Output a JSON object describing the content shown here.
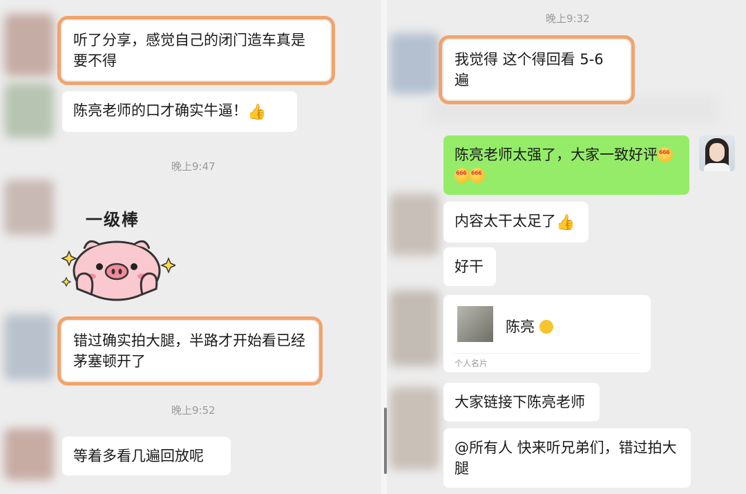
{
  "left": {
    "messages": [
      {
        "text": "听了分享，感觉自己的闭门造车真是要不得"
      },
      {
        "text": "陈亮老师的口才确实牛逼！"
      },
      {
        "text": "错过确实拍大腿，半路才开始看已经茅塞顿开了"
      },
      {
        "text": "等着多看几遍回放呢"
      }
    ],
    "times": [
      "晚上9:47",
      "晚上9:52"
    ],
    "sticker_text": "一级棒"
  },
  "right": {
    "time": "晚上9:32",
    "messages": [
      {
        "text": "我觉得 这个得回看 5-6 遍"
      },
      {
        "text": "陈亮老师太强了，大家一致好评"
      },
      {
        "text": "内容太干太足了"
      },
      {
        "text": "好干"
      },
      {
        "text": "大家链接下陈亮老师"
      },
      {
        "text": "@所有人  快来听兄弟们，错过拍大腿"
      }
    ],
    "card": {
      "name": "陈亮",
      "type": "个人名片"
    }
  },
  "icons": [
    "thumbs-up-icon",
    "emoji-666-icon",
    "tongue-emoji-icon"
  ],
  "colors": {
    "highlight": "#f2a36b",
    "sent_bubble": "#95ec69",
    "background": "#ededed"
  }
}
